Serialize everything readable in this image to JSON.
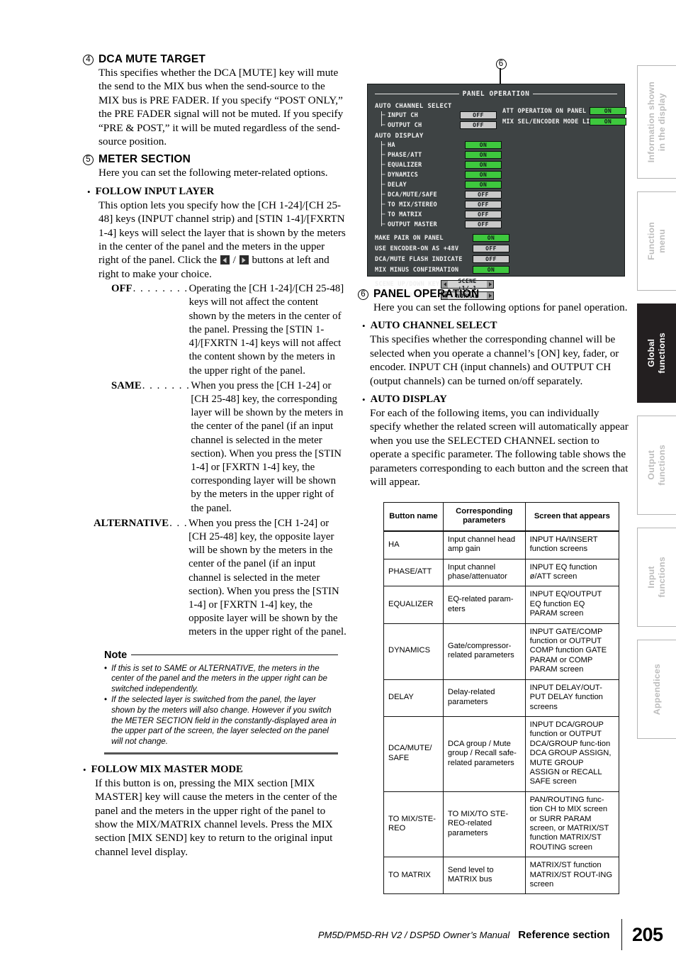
{
  "left_column": {
    "section4": {
      "number": "4",
      "title": "DCA MUTE TARGET",
      "body": "This specifies whether the DCA [MUTE] key will mute the send to the MIX bus when the send-source to the MIX bus is PRE FADER. If you specify “POST ONLY,” the PRE FADER signal will not be muted. If you specify “PRE & POST,” it will be muted regardless of the send-source position."
    },
    "section5": {
      "number": "5",
      "title": "METER SECTION",
      "body": "Here you can set the following meter-related options."
    },
    "follow_input_layer": {
      "title": "FOLLOW INPUT LAYER",
      "body_part1": "This option lets you specify how the [CH 1-24]/[CH 25-48] keys (INPUT channel strip) and [STIN 1-4]/[FXRTN 1-4] keys will select the layer that is shown by the meters in the center of the panel and the meters in the upper right of the panel. Click the",
      "body_part2": "/",
      "body_part3": "buttons at left and right to make your choice.",
      "left_button_icon": "arrow-left-icon",
      "right_button_icon": "arrow-right-icon",
      "options": [
        {
          "term": "OFF",
          "dots": ". . . . . . . .",
          "description": "Operating the [CH 1-24]/[CH 25-48] keys will not affect the content shown by the meters in the center of the panel. Pressing the [STIN 1-4]/[FXRTN 1-4] keys will not affect the content shown by the meters in the upper right of the panel."
        },
        {
          "term": "SAME",
          "dots": ". . . . . . .",
          "description": "When you press the [CH 1-24] or [CH 25-48] key, the corresponding layer will be shown by the meters in the center of the panel (if an input channel is selected in the meter section). When you press the [STIN 1-4] or [FXRTN 1-4] key, the corresponding layer will be shown by the meters in the upper right of the panel."
        },
        {
          "term": "ALTERNATIVE",
          "dots": ". . .",
          "description": "When you press the [CH 1-24] or [CH 25-48] key, the opposite layer will be shown by the meters in the center of the panel (if an input channel is selected in the meter section). When you press the [STIN 1-4] or [FXRTN 1-4] key, the opposite layer will be shown by the meters in the upper right of the panel."
        }
      ]
    },
    "note": {
      "label": "Note",
      "items": [
        "If this is set to SAME or ALTERNATIVE, the meters in the center of the panel and the meters in the upper right can be switched independently.",
        "If the selected layer is switched from the panel, the layer shown by the meters will also change. However if you switch the METER SECTION field in the constantly-displayed area in the upper part of the screen, the layer selected on the panel will not change."
      ]
    },
    "follow_mix_master_mode": {
      "title": "FOLLOW MIX MASTER MODE",
      "body": "If this button is on, pressing the MIX section [MIX MASTER] key will cause the meters in the center of the panel and the meters in the upper right of the panel to show the MIX/MATRIX channel levels. Press the MIX section [MIX SEND] key to return to the original input channel level display."
    }
  },
  "lcd": {
    "callout_number": "6",
    "title": "PANEL OPERATION",
    "group_auto_channel_select": "AUTO CHANNEL SELECT",
    "group_auto_display": "AUTO DISPLAY",
    "auto_channel_select": [
      {
        "label": "INPUT CH",
        "value": "OFF"
      },
      {
        "label": "OUTPUT CH",
        "value": "OFF"
      }
    ],
    "auto_display": [
      {
        "label": "HA",
        "value": "ON"
      },
      {
        "label": "PHASE/ATT",
        "value": "ON"
      },
      {
        "label": "EQUALIZER",
        "value": "ON"
      },
      {
        "label": "DYNAMICS",
        "value": "ON"
      },
      {
        "label": "DELAY",
        "value": "ON"
      },
      {
        "label": "DCA/MUTE/SAFE",
        "value": "OFF"
      },
      {
        "label": "TO MIX/STEREO",
        "value": "OFF"
      },
      {
        "label": "TO MATRIX",
        "value": "OFF"
      },
      {
        "label": "OUTPUT MASTER",
        "value": "OFF"
      }
    ],
    "misc_toggles": [
      {
        "label": "MAKE PAIR ON PANEL",
        "value": "ON"
      },
      {
        "label": "USE ENCODER-ON AS +48V",
        "value": "OFF"
      },
      {
        "label": "DCA/MUTE FLASH INDICATE",
        "value": "OFF"
      },
      {
        "label": "MIX MINUS CONFIRMATION",
        "value": "ON"
      }
    ],
    "selectors": [
      {
        "label": "SCENE UP/DOWN KEY",
        "value": "SCENE +1/-1"
      },
      {
        "label": "LIST ORDER",
        "value": "NORMAL"
      }
    ],
    "right_toggles": [
      {
        "label": "ATT OPERATION ON PANEL",
        "value": "ON"
      },
      {
        "label": "MIX SEL/ENCODER MODE LINK",
        "value": "ON"
      }
    ],
    "colors": {
      "on": "#3ec83e",
      "off": "#c9c9c9",
      "background": "#3e4344"
    }
  },
  "right_column": {
    "section6": {
      "number": "6",
      "title": "PANEL OPERATION",
      "body": "Here you can set the following options for panel operation."
    },
    "auto_channel_select": {
      "title": "AUTO CHANNEL SELECT",
      "body": "This specifies whether the corresponding channel will be selected when you operate a channel’s [ON] key, fader, or encoder. INPUT CH (input channels) and OUTPUT CH (output channels) can be turned on/off separately."
    },
    "auto_display": {
      "title": "AUTO DISPLAY",
      "body": "For each of the following items, you can individually specify whether the related screen will automatically appear when you use the SELECTED CHANNEL section to operate a specific parameter. The following table shows the parameters corresponding to each button and the screen that will appear."
    },
    "table": {
      "headers": [
        "Button name",
        "Corresponding parameters",
        "Screen that appears"
      ],
      "rows": [
        [
          "HA",
          "Input channel head amp gain",
          "INPUT HA/INSERT function screens"
        ],
        [
          "PHASE/ATT",
          "Input channel phase/attenuator",
          "INPUT EQ function ø/ATT screen"
        ],
        [
          "EQUALIZER",
          "EQ-related param-eters",
          "INPUT EQ/OUTPUT EQ function EQ PARAM screen"
        ],
        [
          "DYNAMICS",
          "Gate/compressor-related parameters",
          "INPUT GATE/COMP function or OUTPUT COMP function GATE PARAM or COMP PARAM screen"
        ],
        [
          "DELAY",
          "Delay-related parameters",
          "INPUT DELAY/OUT-PUT DELAY function screens"
        ],
        [
          "DCA/MUTE/ SAFE",
          "DCA group / Mute group / Recall safe-related parameters",
          "INPUT DCA/GROUP function or OUTPUT DCA/GROUP func-tion DCA GROUP ASSIGN, MUTE GROUP ASSIGN or RECALL SAFE screen"
        ],
        [
          "TO MIX/STE-REO",
          "TO MIX/TO STE-REO-related parameters",
          "PAN/ROUTING func-tion CH to MIX screen or SURR PARAM screen, or MATRIX/ST function MATRIX/ST ROUTING screen"
        ],
        [
          "TO MATRIX",
          "Send level to MATRIX bus",
          "MATRIX/ST function MATRIX/ST ROUT-ING screen"
        ]
      ]
    }
  },
  "side_tabs": [
    {
      "label": "Information shown\nin the display",
      "active": false
    },
    {
      "label": "Function\nmenu",
      "active": false
    },
    {
      "label": "Global\nfunctions",
      "active": true
    },
    {
      "label": "Output\nfunctions",
      "active": false
    },
    {
      "label": "Input\nfunctions",
      "active": false
    },
    {
      "label": "Appendices",
      "active": false
    }
  ],
  "footer": {
    "manual": "PM5D/PM5D-RH V2 / DSP5D Owner’s Manual",
    "section": "Reference section",
    "page": "205"
  }
}
